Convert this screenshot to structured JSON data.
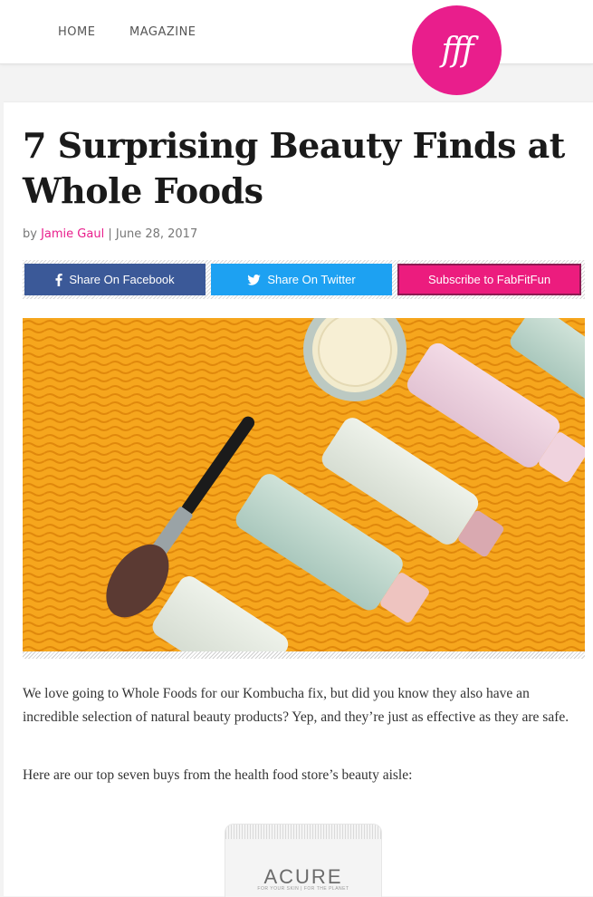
{
  "header": {
    "nav": [
      {
        "label": "HOME"
      },
      {
        "label": "MAGAZINE"
      }
    ],
    "logo_text": "fff",
    "brand_color": "#e91e8c"
  },
  "article": {
    "title": "7 Surprising Beauty Finds at Whole Foods",
    "byline_prefix": "by",
    "author": "Jamie Gaul",
    "separator": "|",
    "date": "June 28, 2017",
    "paragraphs": [
      "We love going to Whole Foods for our Kombucha fix, but did you know they also have an incredible selection of natural beauty products? Yep, and they’re just as effective as they are safe.",
      "Here are our top seven buys from the health food store’s beauty aisle:"
    ]
  },
  "share": {
    "facebook_label": "Share On Facebook",
    "twitter_label": "Share On Twitter",
    "subscribe_label": "Subscribe to FabFitFun",
    "facebook_color": "#3b5998",
    "twitter_color": "#1da1f2",
    "subscribe_color": "#ec1c7e",
    "facebook_icon": "facebook-icon",
    "twitter_icon": "twitter-icon"
  },
  "product": {
    "brand": "ACURE",
    "tagline": "FOR YOUR SKIN | FOR THE PLANET"
  }
}
